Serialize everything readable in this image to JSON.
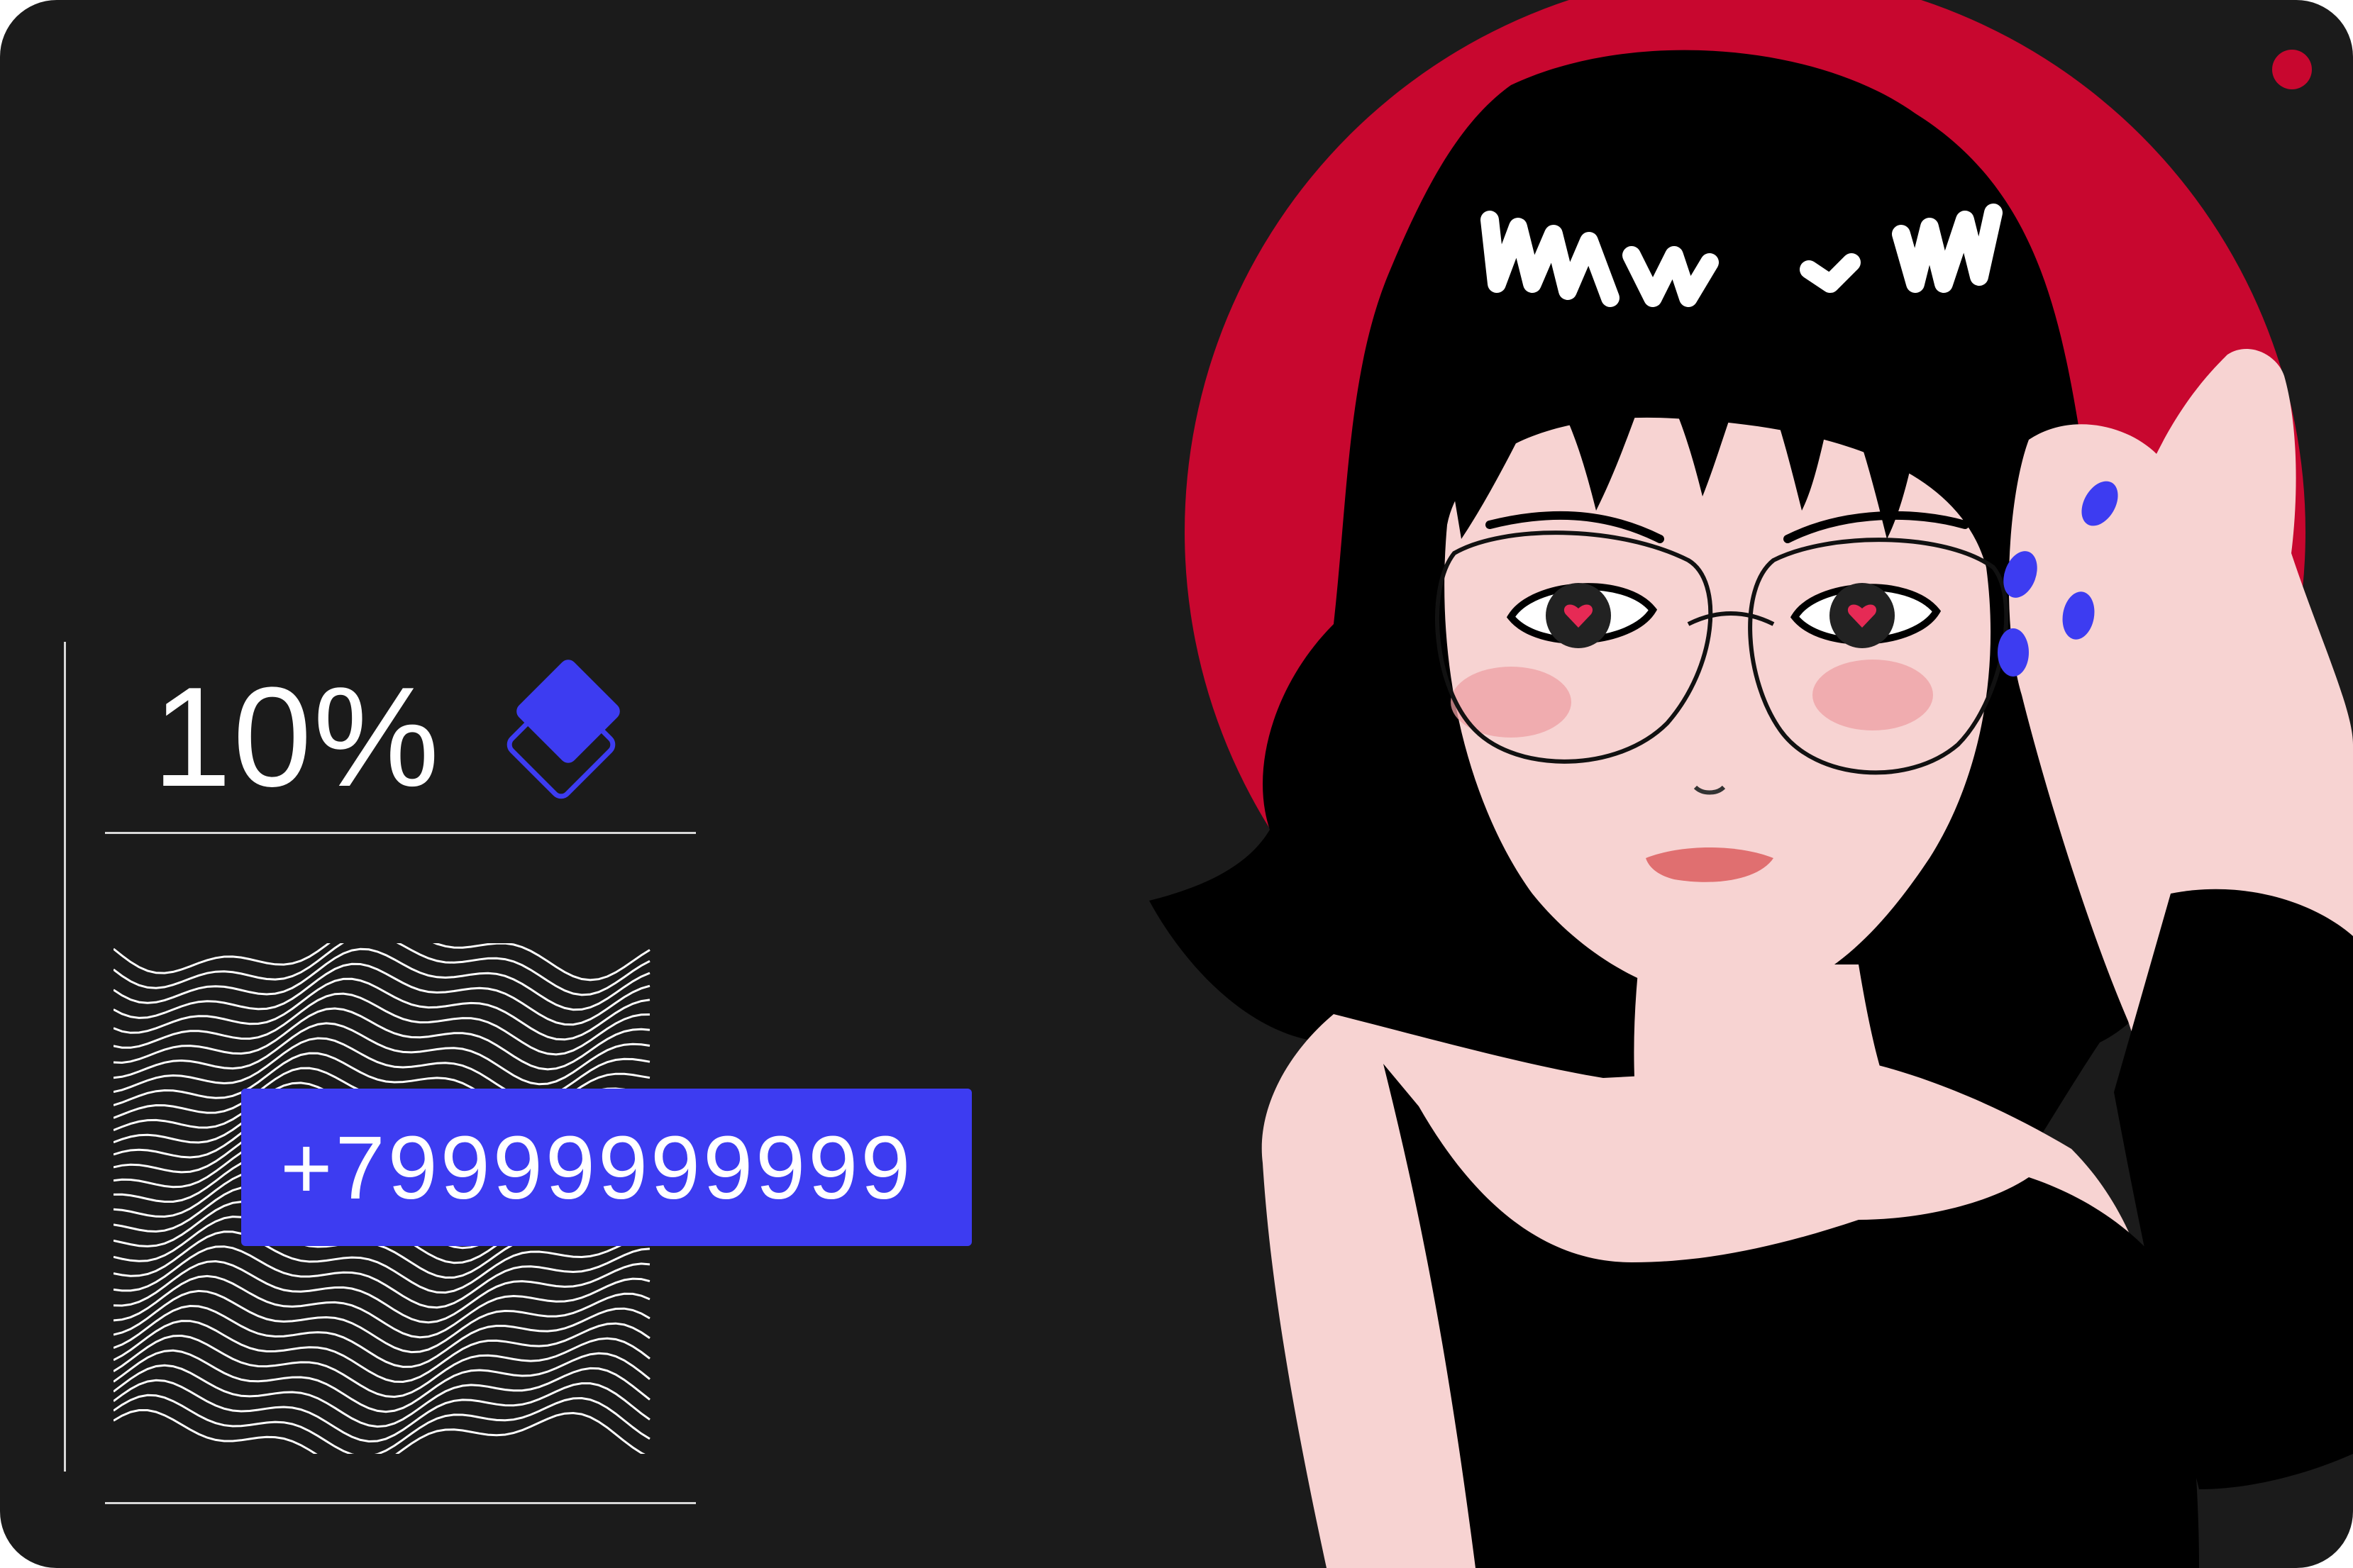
{
  "discount": {
    "value": "10%"
  },
  "contact": {
    "phone": "+79999999999"
  },
  "icons": {
    "layers": "layers-icon",
    "wave": "wave-pattern-icon",
    "indicator": "record-dot-icon"
  },
  "colors": {
    "background": "#1b1b1b",
    "accent": "#3d3cf1",
    "red": "#c8072f",
    "skin": "#f7d3d2",
    "hair": "#000000",
    "lines": "#d8d8d8"
  }
}
